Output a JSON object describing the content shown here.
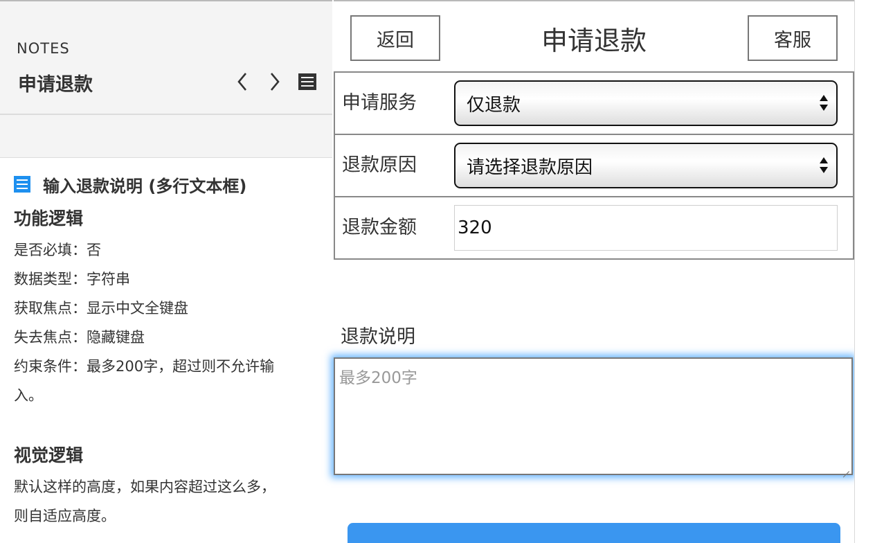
{
  "notes": {
    "header_label": "NOTES",
    "page_title": "申请退款",
    "icons": {
      "prev": "chevron-left-icon",
      "next": "chevron-right-icon",
      "menu": "menu-icon",
      "doc": "document-icon"
    },
    "item_title": "输入退款说明 (多行文本框)",
    "functional": {
      "heading": "功能逻辑",
      "lines": [
        "是否必填：否",
        "数据类型：字符串",
        "获取焦点：显示中文全键盘",
        "失去焦点：隐藏键盘",
        "约束条件：最多200字，超过则不允许输",
        "入。"
      ]
    },
    "visual": {
      "heading": "视觉逻辑",
      "lines": [
        "默认这样的高度，如果内容超过这么多，",
        "则自适应高度。"
      ]
    }
  },
  "phone": {
    "header": {
      "back_label": "返回",
      "title": "申请退款",
      "service_label": "客服"
    },
    "form": {
      "service": {
        "label": "申请服务",
        "value": "仅退款"
      },
      "reason": {
        "label": "退款原因",
        "value": "请选择退款原因"
      },
      "amount": {
        "label": "退款金额",
        "value": "320"
      },
      "description": {
        "label": "退款说明",
        "placeholder": "最多200字"
      }
    },
    "colors": {
      "accent": "#3a96f0",
      "focus_glow": "#1e90ff",
      "doc_icon": "#1e90ef"
    }
  }
}
